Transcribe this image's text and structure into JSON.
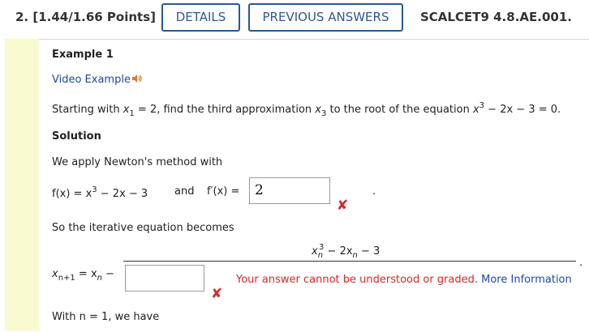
{
  "header": {
    "question_label": "2. [1.44/1.66 Points]",
    "details_button": "DETAILS",
    "previous_answers_button": "PREVIOUS ANSWERS",
    "question_id": "SCALCET9 4.8.AE.001."
  },
  "example": {
    "title": "Example 1",
    "video_link": "Video Example",
    "prompt": {
      "part1": "Starting with ",
      "x": "x",
      "sub1": "1",
      "part2": " = 2, find the third approximation ",
      "sub3": "3",
      "part3": " to the root of the equation ",
      "sup3": "3",
      "part4": " − 2x − 3 = 0."
    }
  },
  "solution": {
    "heading": "Solution",
    "newton_text": "We apply Newton's method with",
    "f_expr": {
      "lead": "f(x) = x",
      "exp": "3",
      "tail": " − 2x − 3"
    },
    "and_text": "and",
    "fprime_label": "f′(x) =",
    "fprime_answer": "2",
    "period": ".",
    "iterative_text": "So the iterative equation becomes",
    "numerator": {
      "x": "x",
      "sub": "n",
      "exp": "3",
      "mid": " − 2x",
      "sub2": "n",
      "tail": " − 3"
    },
    "lhs": {
      "x": "x",
      "sub": "n+1",
      "eq": " = x",
      "sub2": "n",
      "minus": " −"
    },
    "denominator_answer": "",
    "error_message": "Your answer cannot be understood or graded.",
    "more_info_link": "More Information",
    "with_n": "With n = 1, we have"
  },
  "colors": {
    "accent": "#2a5a90",
    "link": "#1b4ba0",
    "error": "#d42a2a",
    "sidebar": "#fafad0"
  }
}
